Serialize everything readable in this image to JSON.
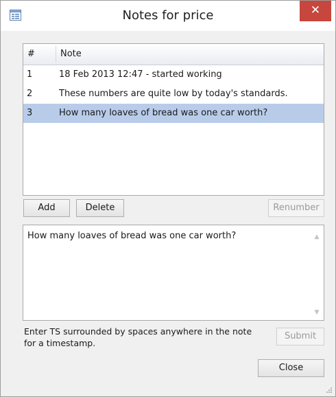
{
  "window": {
    "title": "Notes for price",
    "close_glyph": "✕"
  },
  "list": {
    "columns": [
      "#",
      "Note"
    ],
    "rows": [
      {
        "num": "1",
        "note": "18 Feb 2013 12:47 - started working"
      },
      {
        "num": "2",
        "note": "These numbers are quite low by today's standards."
      },
      {
        "num": "3",
        "note": "How many loaves of bread was one car worth?"
      }
    ],
    "selected_row": 3
  },
  "buttons": {
    "add": "Add",
    "delete": "Delete",
    "renumber": "Renumber",
    "submit": "Submit",
    "close": "Close"
  },
  "editor": {
    "value": "How many loaves of bread was one car worth?"
  },
  "hint": "Enter TS surrounded by spaces anywhere in the note for a timestamp.",
  "colors": {
    "selection": "#b8ccea",
    "close_button": "#c7463d"
  },
  "icons": {
    "app": "form-icon",
    "scroll_up": "chevron-up-icon",
    "scroll_down": "chevron-down-icon",
    "grip": "resize-grip-icon"
  }
}
